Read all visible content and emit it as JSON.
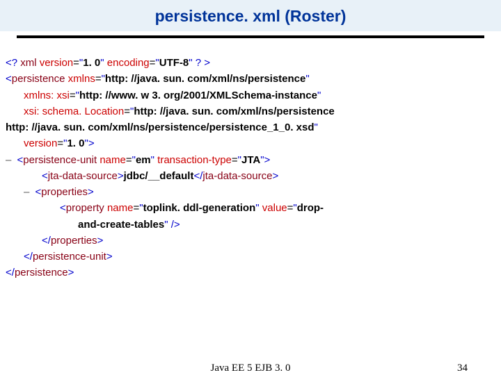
{
  "title": "persistence. xml (Roster)",
  "footer_center": "Java EE 5 EJB 3. 0",
  "footer_right": "34",
  "xml": {
    "decl_version": "1. 0",
    "decl_encoding": "UTF-8",
    "root": "persistence",
    "attr_xmlns": "xmlns",
    "val_xmlns": "http: //java. sun. com/xml/ns/persistence",
    "attr_xsi": "xmlns: xsi",
    "val_xsi": "http: //www. w 3. org/2001/XMLSchema-instance",
    "attr_schemaloc": "xsi: schema. Location",
    "val_schemaloc1": "http: //java. sun. com/xml/ns/persistence",
    "val_schemaloc2": "http: //java. sun. com/xml/ns/persistence/persistence_1_0. xsd",
    "attr_version": "version",
    "val_version": "1. 0",
    "pu_tag": "persistence-unit",
    "pu_name_attr": "name",
    "pu_name_val": "em",
    "pu_tx_attr": "transaction-type",
    "pu_tx_val": "JTA",
    "jta_tag": "jta-data-source",
    "jta_val": "jdbc/__default",
    "props_tag": "properties",
    "prop_tag": "property",
    "prop_name_attr": "name",
    "prop_name_val": "toplink. ddl-generation",
    "prop_value_attr": "value",
    "prop_value_val1": "drop-",
    "prop_value_val2": "and-create-tables"
  }
}
